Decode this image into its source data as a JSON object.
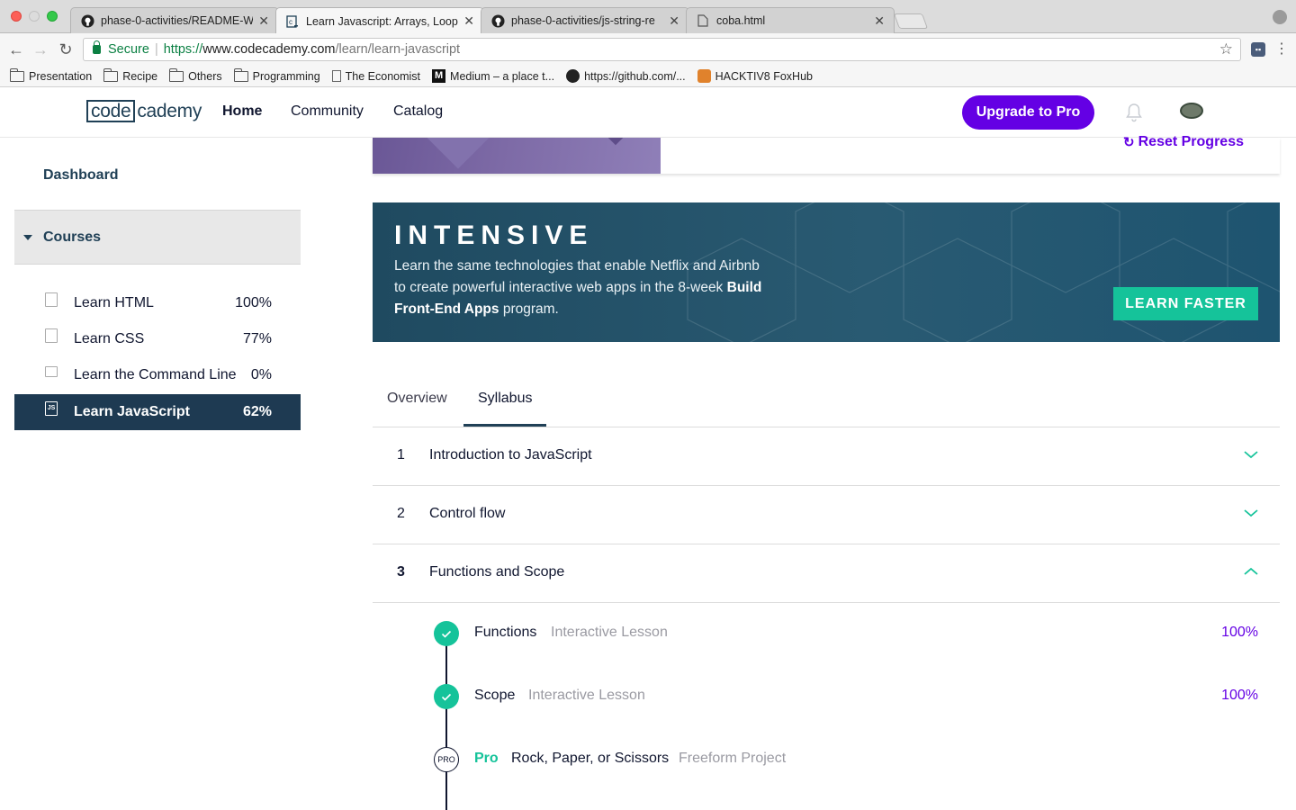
{
  "browser": {
    "tabs": [
      {
        "title": "phase-0-activities/README-W",
        "icon": "github-icon"
      },
      {
        "title": "Learn Javascript: Arrays, Loop",
        "icon": "codecademy-icon"
      },
      {
        "title": "phase-0-activities/js-string-re",
        "icon": "github-icon"
      },
      {
        "title": "coba.html",
        "icon": "page-icon"
      }
    ],
    "secure_label": "Secure",
    "url_scheme": "https://",
    "url_host": "www.codecademy.com",
    "url_path": "/learn/learn-javascript",
    "bookmarks": [
      {
        "label": "Presentation",
        "icon": "folder-icon"
      },
      {
        "label": "Recipe",
        "icon": "folder-icon"
      },
      {
        "label": "Others",
        "icon": "folder-icon"
      },
      {
        "label": "Programming",
        "icon": "folder-icon"
      },
      {
        "label": "The Economist",
        "icon": "page-icon"
      },
      {
        "label": "Medium – a place t...",
        "icon": "medium-icon"
      },
      {
        "label": "https://github.com/...",
        "icon": "github-icon"
      },
      {
        "label": "HACKTIV8 FoxHub",
        "icon": "fox-icon"
      }
    ]
  },
  "header": {
    "logo_code": "code",
    "logo_cademy": "cademy",
    "nav": [
      "Home",
      "Community",
      "Catalog"
    ],
    "upgrade_label": "Upgrade to Pro"
  },
  "sidebar": {
    "dashboard": "Dashboard",
    "courses_label": "Courses",
    "courses": [
      {
        "name": "Learn HTML",
        "progress": "100%",
        "icon": "html-icon"
      },
      {
        "name": "Learn CSS",
        "progress": "77%",
        "icon": "css-icon"
      },
      {
        "name": "Learn the Command Line",
        "progress": "0%",
        "icon": "terminal-icon"
      },
      {
        "name": "Learn JavaScript",
        "progress": "62%",
        "icon": "js-icon",
        "active": true
      }
    ]
  },
  "main": {
    "reset_label": "Reset Progress",
    "banner": {
      "title": "INTENSIVE",
      "text_1": "Learn the same technologies that enable Netflix and Airbnb to create powerful interactive web apps in the 8-week ",
      "text_bold": "Build Front-End Apps",
      "text_2": " program.",
      "cta": "LEARN FASTER"
    },
    "tabs": [
      "Overview",
      "Syllabus"
    ],
    "selected_tab": "Syllabus",
    "modules": [
      {
        "num": "1",
        "title": "Introduction to JavaScript",
        "expanded": false
      },
      {
        "num": "2",
        "title": "Control flow",
        "expanded": false
      },
      {
        "num": "3",
        "title": "Functions and Scope",
        "expanded": true
      }
    ],
    "lessons": [
      {
        "name": "Functions",
        "type": "Interactive Lesson",
        "progress": "100%",
        "status": "complete"
      },
      {
        "name": "Scope",
        "type": "Interactive Lesson",
        "progress": "100%",
        "status": "complete"
      },
      {
        "badge": "Pro",
        "pro_marker": "PRO",
        "name": "Rock, Paper, or Scissors",
        "type": "Freeform Project",
        "status": "pro"
      }
    ]
  },
  "colors": {
    "brand_purple": "#6400e4",
    "teal": "#15c39a",
    "navy": "#204056",
    "sidebar_active": "#1e3a52"
  }
}
